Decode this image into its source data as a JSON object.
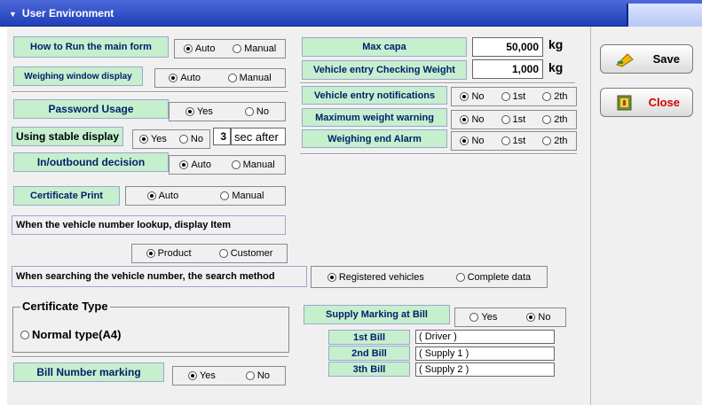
{
  "window": {
    "title": "User Environment"
  },
  "how_to_run": {
    "label": "How to Run the main form",
    "options": [
      "Auto",
      "Manual"
    ],
    "selected": "Auto"
  },
  "weighing_window": {
    "label": "Weighing window display",
    "options": [
      "Auto",
      "Manual"
    ],
    "selected": "Auto"
  },
  "password_usage": {
    "label": "Password Usage",
    "options": [
      "Yes",
      "No"
    ],
    "selected": "Yes"
  },
  "stable_display": {
    "label": "Using stable display",
    "options": [
      "Yes",
      "No"
    ],
    "selected": "Yes",
    "seconds": "3",
    "suffix": "sec after"
  },
  "inout_decision": {
    "label": "In/outbound decision",
    "options": [
      "Auto",
      "Manual"
    ],
    "selected": "Auto"
  },
  "certificate_print": {
    "label": "Certificate Print",
    "options": [
      "Auto",
      "Manual"
    ],
    "selected": "Auto"
  },
  "lookup_display": {
    "label": "When the vehicle number lookup,  display Item",
    "options": [
      "Product",
      "Customer"
    ],
    "selected": "Product"
  },
  "search_method": {
    "label": "When searching the vehicle number, the search method",
    "options": [
      "Registered vehicles",
      "Complete data"
    ],
    "selected": "Registered vehicles"
  },
  "certificate_type": {
    "label": "Certificate Type",
    "option": "Normal type(A4)"
  },
  "bill_number": {
    "label": "Bill Number marking",
    "options": [
      "Yes",
      "No"
    ],
    "selected": "Yes"
  },
  "max_capa": {
    "label": "Max capa",
    "value": "50,000",
    "unit": "kg"
  },
  "entry_check_weight": {
    "label": "Vehicle entry Checking Weight",
    "value": "1,000",
    "unit": "kg"
  },
  "entry_notifications": {
    "label": "Vehicle entry notifications",
    "options": [
      "No",
      "1st",
      "2th"
    ],
    "selected": "No"
  },
  "max_weight_warning": {
    "label": "Maximum weight warning",
    "options": [
      "No",
      "1st",
      "2th"
    ],
    "selected": "No"
  },
  "weighing_end_alarm": {
    "label": "Weighing end Alarm",
    "options": [
      "No",
      "1st",
      "2th"
    ],
    "selected": "No"
  },
  "supply_marking": {
    "label": "Supply Marking at Bill",
    "options": [
      "Yes",
      "No"
    ],
    "selected": "No"
  },
  "bills": [
    {
      "label": "1st  Bill",
      "value": "( Driver )"
    },
    {
      "label": "2nd Bill",
      "value": "( Supply 1 )"
    },
    {
      "label": "3th  Bill",
      "value": "( Supply 2 )"
    }
  ],
  "buttons": {
    "save": "Save",
    "close": "Close"
  },
  "colors": {
    "label_bg": "#c6efce",
    "title_bar": "#1f3fb8",
    "close_text": "#d40000"
  }
}
